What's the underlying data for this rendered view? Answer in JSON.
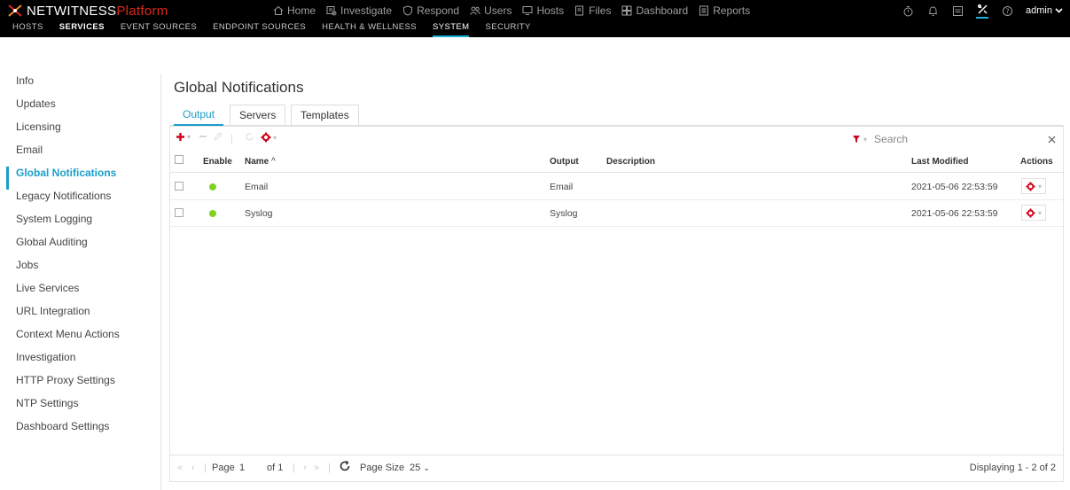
{
  "brand": {
    "name": "NETWITNESS",
    "suffix": "Platform",
    "accent": "#e0261b"
  },
  "main_nav": [
    {
      "label": "Home",
      "icon": "home-icon"
    },
    {
      "label": "Investigate",
      "icon": "investigate-icon"
    },
    {
      "label": "Respond",
      "icon": "respond-icon"
    },
    {
      "label": "Users",
      "icon": "users-icon"
    },
    {
      "label": "Hosts",
      "icon": "hosts-icon"
    },
    {
      "label": "Files",
      "icon": "files-icon"
    },
    {
      "label": "Dashboard",
      "icon": "dashboard-icon"
    },
    {
      "label": "Reports",
      "icon": "reports-icon"
    }
  ],
  "user": {
    "name": "admin"
  },
  "sub_nav": [
    {
      "label": "HOSTS"
    },
    {
      "label": "SERVICES"
    },
    {
      "label": "EVENT SOURCES"
    },
    {
      "label": "ENDPOINT SOURCES"
    },
    {
      "label": "HEALTH & WELLNESS"
    },
    {
      "label": "SYSTEM"
    },
    {
      "label": "SECURITY"
    }
  ],
  "left_menu": [
    {
      "label": "Info"
    },
    {
      "label": "Updates"
    },
    {
      "label": "Licensing"
    },
    {
      "label": "Email"
    },
    {
      "label": "Global Notifications"
    },
    {
      "label": "Legacy Notifications"
    },
    {
      "label": "System Logging"
    },
    {
      "label": "Global Auditing"
    },
    {
      "label": "Jobs"
    },
    {
      "label": "Live Services"
    },
    {
      "label": "URL Integration"
    },
    {
      "label": "Context Menu Actions"
    },
    {
      "label": "Investigation"
    },
    {
      "label": "HTTP Proxy Settings"
    },
    {
      "label": "NTP Settings"
    },
    {
      "label": "Dashboard Settings"
    }
  ],
  "page": {
    "title": "Global Notifications",
    "tabs": [
      {
        "label": "Output"
      },
      {
        "label": "Servers"
      },
      {
        "label": "Templates"
      }
    ]
  },
  "search": {
    "placeholder": "Search"
  },
  "grid": {
    "columns": {
      "enable": "Enable",
      "name": "Name",
      "output": "Output",
      "description": "Description",
      "last_modified": "Last Modified",
      "actions": "Actions"
    },
    "rows": [
      {
        "name": "Email",
        "output": "Email",
        "description": "",
        "last_modified": "2021-05-06 22:53:59"
      },
      {
        "name": "Syslog",
        "output": "Syslog",
        "description": "",
        "last_modified": "2021-05-06 22:53:59"
      }
    ]
  },
  "pager": {
    "page_label": "Page",
    "page": "1",
    "of_label": "of 1",
    "page_size_label": "Page Size",
    "page_size": "25",
    "displaying": "Displaying 1 - 2 of 2"
  },
  "colors": {
    "accent": "#1a9fc9",
    "action_red": "#d0021b",
    "enabled_green": "#7ed321"
  }
}
